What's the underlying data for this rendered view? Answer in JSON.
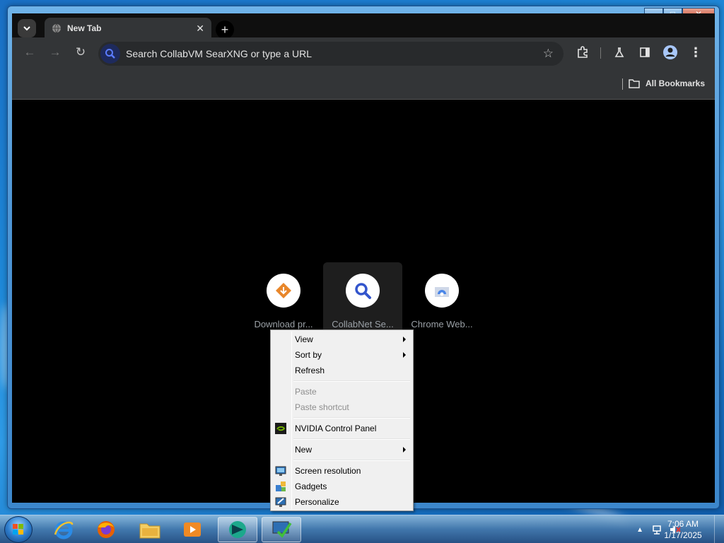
{
  "browser": {
    "tab_title": "New Tab",
    "omnibox_placeholder": "Search CollabVM SearXNG or type a URL",
    "bookmarks_label": "All Bookmarks"
  },
  "shortcuts": [
    {
      "label": "Download pr...",
      "icon": "download-diamond-icon",
      "color": "#e8862a"
    },
    {
      "label": "CollabNet Se...",
      "icon": "search-icon",
      "color": "#3355cc"
    },
    {
      "label": "Chrome Web...",
      "icon": "chrome-web-store-icon",
      "color": "#4a86e8"
    }
  ],
  "context_menu": {
    "items": [
      {
        "label": "View",
        "submenu": true,
        "disabled": false
      },
      {
        "label": "Sort by",
        "submenu": true,
        "disabled": false
      },
      {
        "label": "Refresh",
        "submenu": false,
        "disabled": false
      },
      {
        "label": "Paste",
        "submenu": false,
        "disabled": true
      },
      {
        "label": "Paste shortcut",
        "submenu": false,
        "disabled": true
      },
      {
        "label": "NVIDIA Control Panel",
        "submenu": false,
        "disabled": false,
        "icon": "nvidia-icon"
      },
      {
        "label": "New",
        "submenu": true,
        "disabled": false
      },
      {
        "label": "Screen resolution",
        "submenu": false,
        "disabled": false,
        "icon": "screen-resolution-icon"
      },
      {
        "label": "Gadgets",
        "submenu": false,
        "disabled": false,
        "icon": "gadgets-icon"
      },
      {
        "label": "Personalize",
        "submenu": false,
        "disabled": false,
        "icon": "personalize-icon"
      }
    ]
  },
  "taskbar": {
    "clock_time": "7:06 AM",
    "clock_date": "1/17/2025"
  },
  "colors": {
    "accent": "#1f6fc4",
    "browser_dark": "#333537",
    "menu_bg": "#f0f0f0"
  }
}
